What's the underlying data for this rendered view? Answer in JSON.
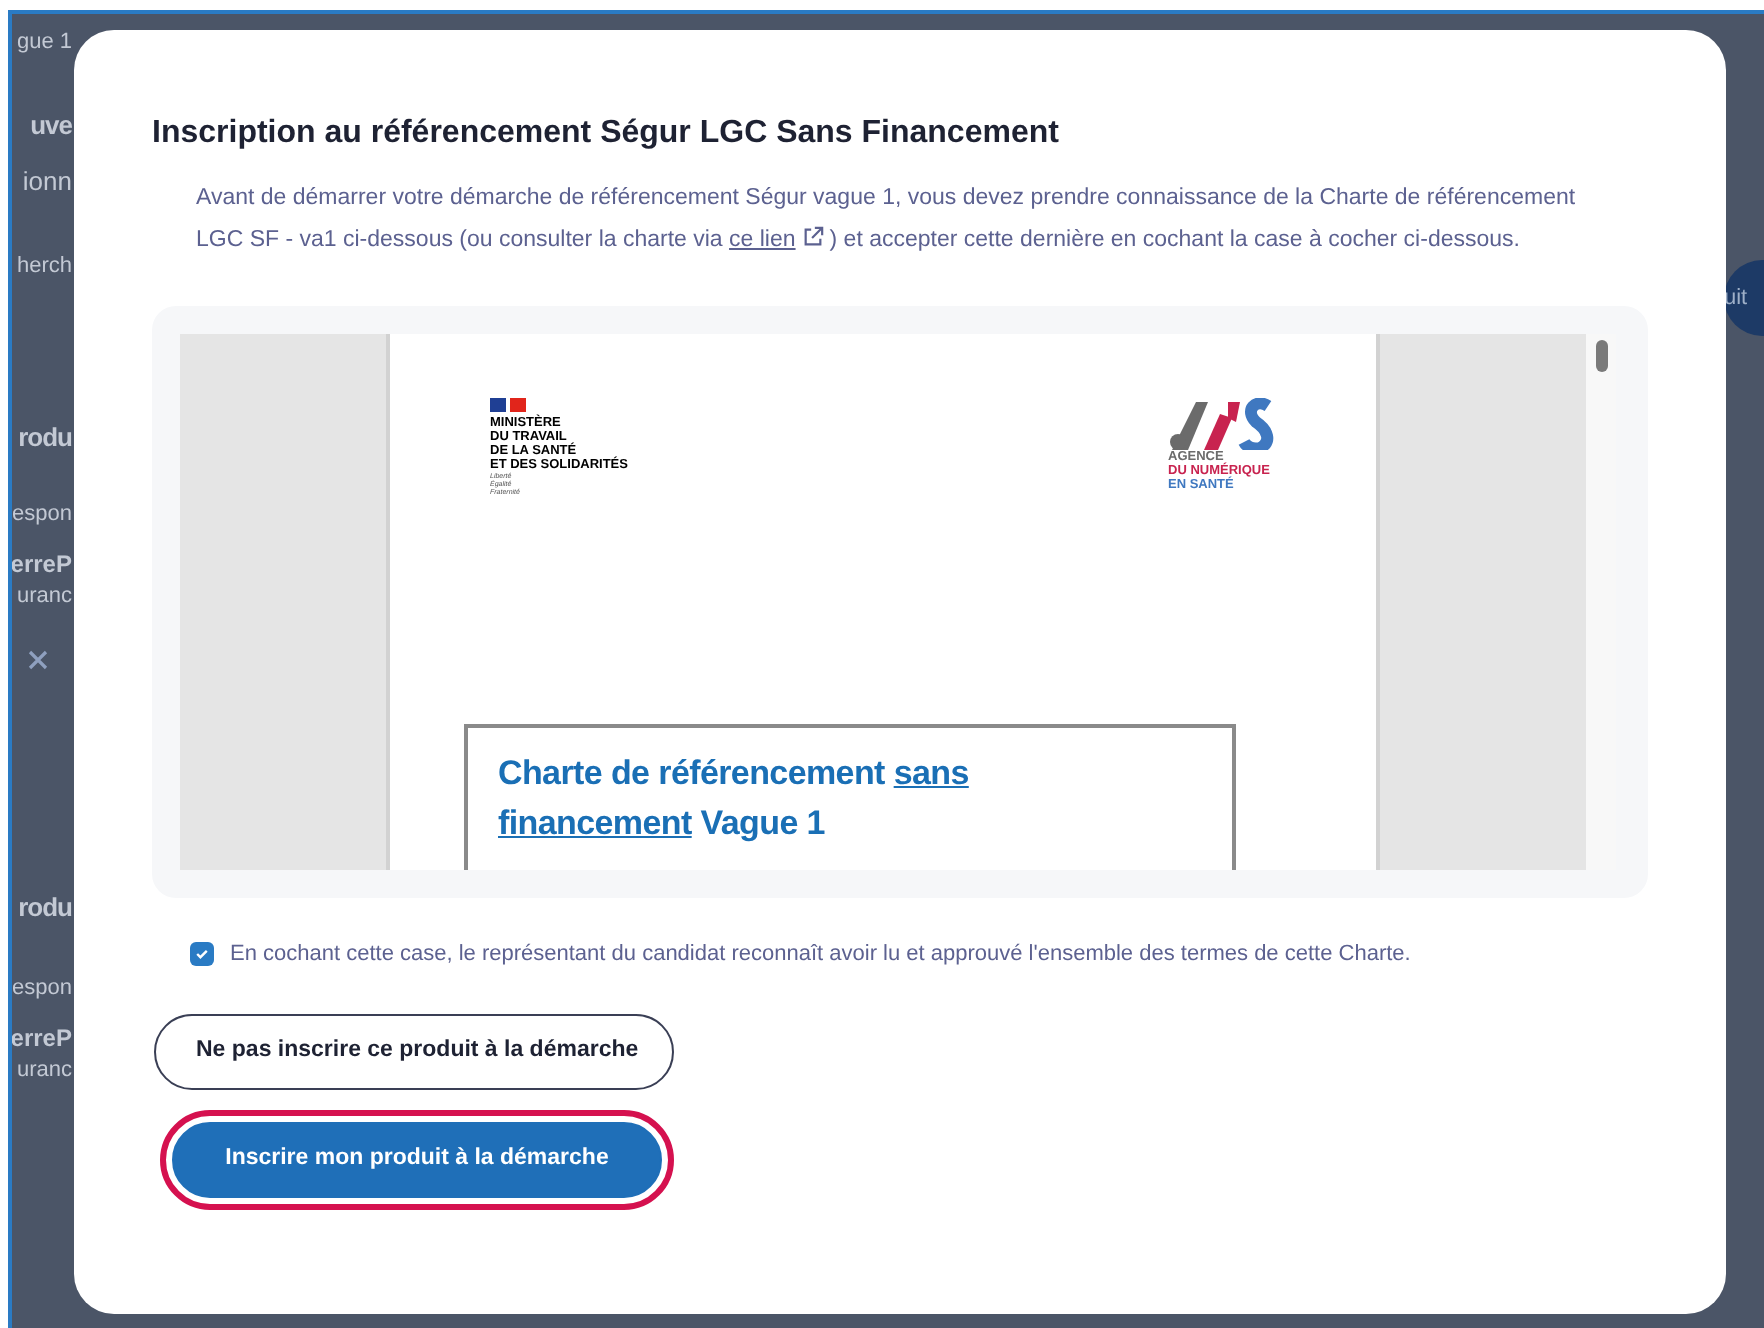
{
  "background": {
    "fragments": [
      {
        "text": "gue 1",
        "kind": "crumb"
      },
      {
        "text": "uve",
        "kind": "heading"
      },
      {
        "text": "ionn",
        "kind": "subtitle"
      },
      {
        "text": "herch",
        "kind": "search"
      },
      {
        "text": "rodu",
        "kind": "heading"
      },
      {
        "text": "espon",
        "kind": "label"
      },
      {
        "text": "erreP",
        "kind": "value"
      },
      {
        "text": "uranc",
        "kind": "label"
      },
      {
        "text": "rodu",
        "kind": "heading"
      },
      {
        "text": "espon",
        "kind": "label"
      },
      {
        "text": "erreP",
        "kind": "value"
      },
      {
        "text": "uranc",
        "kind": "label"
      }
    ],
    "side_button": "uit"
  },
  "dialog": {
    "title": "Inscription au référencement Ségur LGC Sans Financement",
    "intro": {
      "before": "Avant de démarrer votre démarche de référencement Ségur vague 1, vous devez prendre connaissance de la Charte de référencement LGC SF - va1 ci-dessous (ou consulter la charte via ",
      "link": "ce lien",
      "after": ") et accepter cette dernière en cochant la case à cocher ci-dessous."
    },
    "document": {
      "ministry": [
        "MINISTÈRE",
        "DU TRAVAIL",
        "DE LA SANTÉ",
        "ET DES SOLIDARITÉS"
      ],
      "motto": [
        "Liberté",
        "Égalité",
        "Fraternité"
      ],
      "agency": [
        {
          "text": "AGENCE",
          "color": "#6b6b6b"
        },
        {
          "text": "DU NUMÉRIQUE",
          "color": "#c8234f"
        },
        {
          "text": "EN SANTÉ",
          "color": "#3f78c0"
        }
      ],
      "heading": [
        {
          "text": "Charte de référencement ",
          "underlined": false
        },
        {
          "text": "sans financement",
          "underlined": true
        },
        {
          "text": " Vague 1",
          "underlined": false
        }
      ]
    },
    "consent": {
      "checked": true,
      "label": "En cochant cette case, le représentant du candidat reconnaît avoir lu et approuvé l'ensemble des termes de cette Charte."
    },
    "buttons": [
      {
        "label": "Ne pas inscrire ce produit à la démarche",
        "kind": "secondary",
        "focused": false
      },
      {
        "label": "Inscrire mon produit à la démarche",
        "kind": "primary",
        "focused": true
      }
    ]
  }
}
